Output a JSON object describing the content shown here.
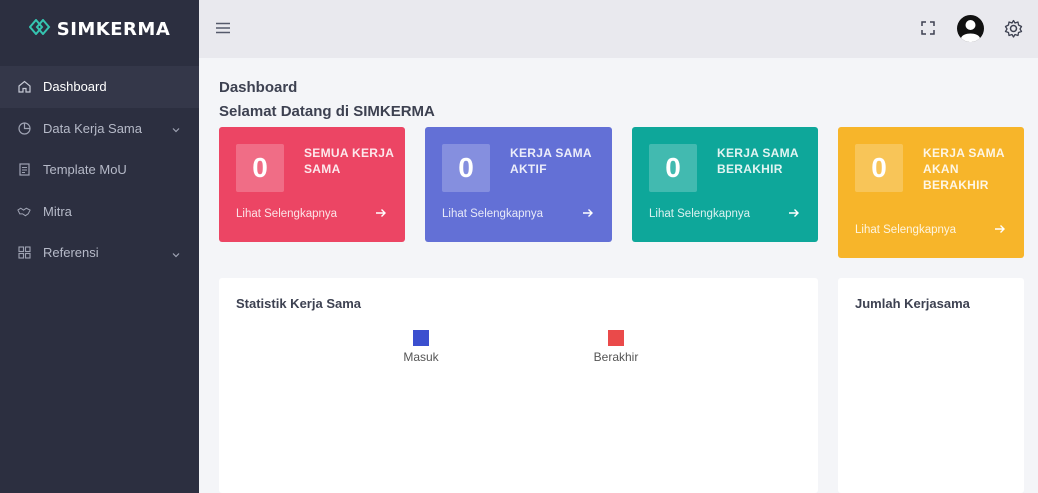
{
  "app": {
    "brand": "SIMKERMA"
  },
  "sidebar": {
    "items": [
      {
        "label": "Dashboard",
        "icon": "home-icon",
        "active": true,
        "has_children": false
      },
      {
        "label": "Data Kerja Sama",
        "icon": "pie-chart-icon",
        "active": false,
        "has_children": true
      },
      {
        "label": "Template MoU",
        "icon": "document-icon",
        "active": false,
        "has_children": false
      },
      {
        "label": "Mitra",
        "icon": "handshake-icon",
        "active": false,
        "has_children": false
      },
      {
        "label": "Referensi",
        "icon": "grid-icon",
        "active": false,
        "has_children": true
      }
    ]
  },
  "header": {
    "title": "Dashboard",
    "welcome": "Selamat Datang di SIMKERMA"
  },
  "cards": [
    {
      "value": "0",
      "title": "SEMUA KERJA SAMA",
      "link": "Lihat Selengkapnya",
      "color": "#ec4564"
    },
    {
      "value": "0",
      "title": "KERJA SAMA AKTIF",
      "link": "Lihat Selengkapnya",
      "color": "#6370d6"
    },
    {
      "value": "0",
      "title": "KERJA SAMA BERAKHIR",
      "link": "Lihat Selengkapnya",
      "color": "#0ea79a"
    },
    {
      "value": "0",
      "title": "KERJA SAMA AKAN BERAKHIR",
      "link": "Lihat Selengkapnya",
      "color": "#f7b52a"
    }
  ],
  "stats_panel": {
    "title": "Statistik Kerja Sama",
    "legend": [
      {
        "label": "Masuk",
        "color": "#3b4fcf"
      },
      {
        "label": "Berakhir",
        "color": "#ea4a4a"
      }
    ]
  },
  "total_panel": {
    "title": "Jumlah Kerjasama"
  }
}
